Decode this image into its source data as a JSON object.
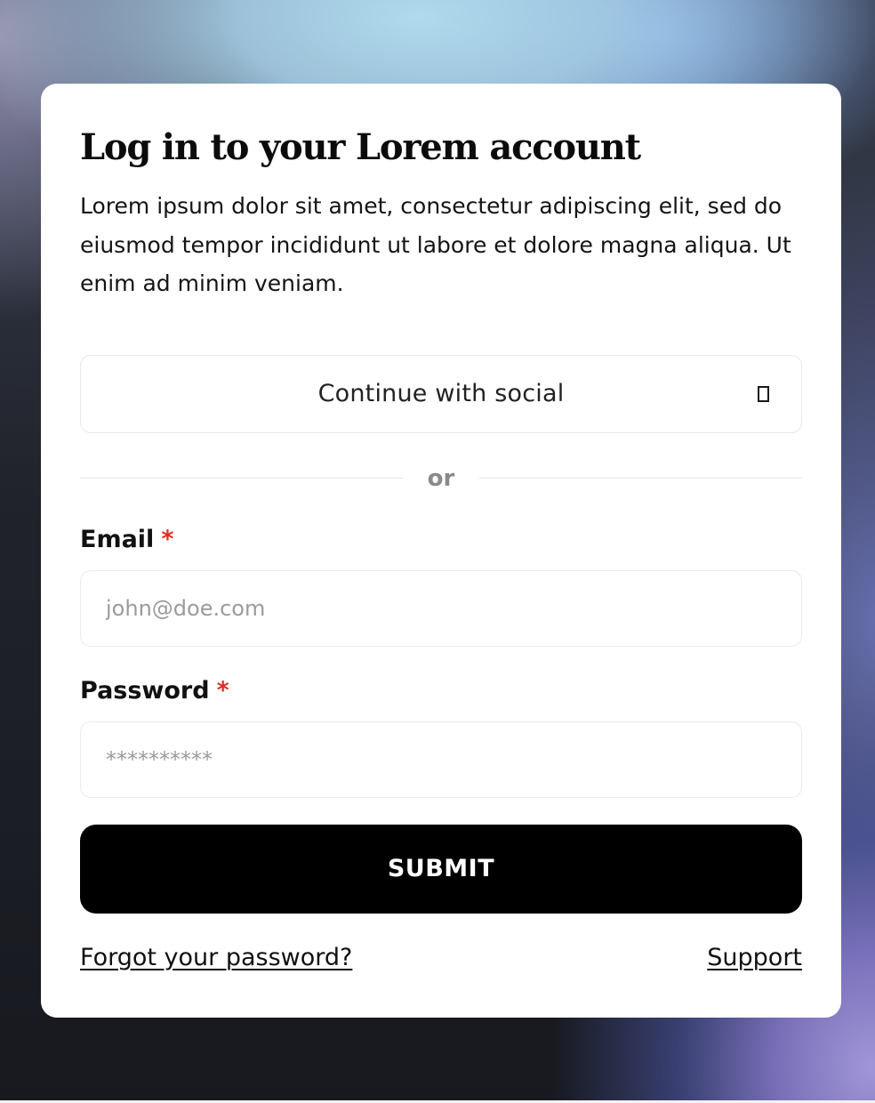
{
  "login": {
    "title": "Log in to your Lorem account",
    "description": "Lorem ipsum dolor sit amet, consectetur adipiscing elit, sed do eiusmod tempor incididunt ut labore et dolore magna aliqua. Ut enim ad minim veniam.",
    "social_button": {
      "label": "Continue with social",
      "icon": "rectangle-icon"
    },
    "divider_text": "or",
    "email": {
      "label": "Email",
      "required_marker": "*",
      "placeholder": "john@doe.com",
      "value": ""
    },
    "password": {
      "label": "Password",
      "required_marker": "*",
      "placeholder": "**********",
      "value": ""
    },
    "submit_label": "SUBMIT",
    "forgot_link": "Forgot your password?",
    "support_link": "Support"
  },
  "colors": {
    "required": "#e32c22",
    "button_bg": "#000000",
    "button_text": "#ffffff",
    "card_bg": "#ffffff"
  }
}
